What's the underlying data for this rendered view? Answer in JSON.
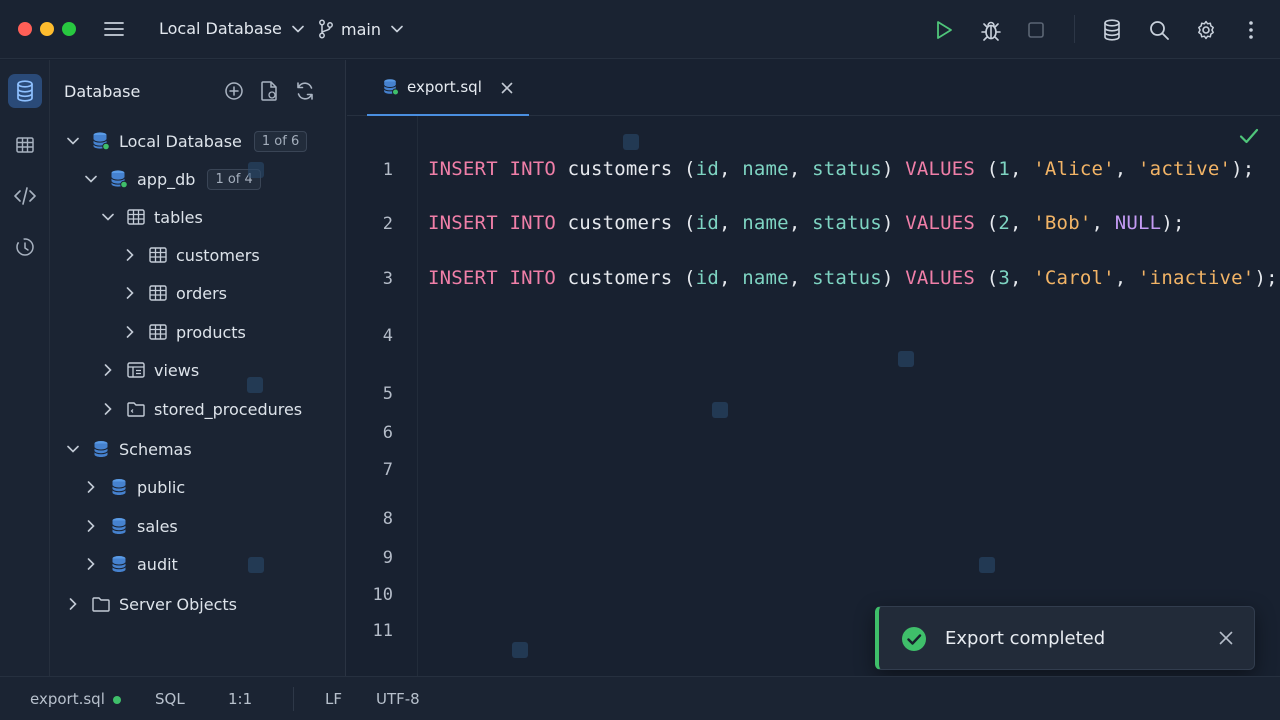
{
  "titlebar": {
    "connection": "Local Database",
    "branch": "main"
  },
  "sidebar": {
    "title": "Database",
    "tree": [
      {
        "label": "Local Database",
        "badge": "1 of 6"
      },
      {
        "label": "app_db",
        "badge": "1 of 4"
      },
      {
        "label": "tables"
      },
      {
        "label": "customers"
      },
      {
        "label": "orders"
      },
      {
        "label": "products"
      },
      {
        "label": "views"
      },
      {
        "label": "stored_procedures"
      },
      {
        "label": "Schemas"
      },
      {
        "label": "public"
      },
      {
        "label": "sales"
      },
      {
        "label": "audit"
      },
      {
        "label": "Server Objects"
      }
    ]
  },
  "editor": {
    "tab_label": "export.sql",
    "line_numbers": [
      "1",
      "2",
      "3",
      "4",
      "5",
      "6",
      "7",
      "8",
      "9",
      "10",
      "11"
    ],
    "lines": [
      [
        {
          "t": "INSERT INTO",
          "c": "kw"
        },
        {
          "t": " customers ("
        },
        {
          "t": "id",
          "c": "col"
        },
        {
          "t": ", "
        },
        {
          "t": "name",
          "c": "col"
        },
        {
          "t": ", "
        },
        {
          "t": "status",
          "c": "col"
        },
        {
          "t": ") "
        },
        {
          "t": "VALUES",
          "c": "kw"
        },
        {
          "t": " ("
        },
        {
          "t": "1",
          "c": "num"
        },
        {
          "t": ", "
        },
        {
          "t": "'Alice'",
          "c": "str"
        },
        {
          "t": ", "
        },
        {
          "t": "'active'",
          "c": "str"
        },
        {
          "t": ");"
        }
      ],
      [
        {
          "t": "INSERT INTO",
          "c": "kw"
        },
        {
          "t": " customers ("
        },
        {
          "t": "id",
          "c": "col"
        },
        {
          "t": ", "
        },
        {
          "t": "name",
          "c": "col"
        },
        {
          "t": ", "
        },
        {
          "t": "status",
          "c": "col"
        },
        {
          "t": ") "
        },
        {
          "t": "VALUES",
          "c": "kw"
        },
        {
          "t": " ("
        },
        {
          "t": "2",
          "c": "num"
        },
        {
          "t": ", "
        },
        {
          "t": "'Bob'",
          "c": "str"
        },
        {
          "t": ", "
        },
        {
          "t": "NULL",
          "c": "nul"
        },
        {
          "t": ");"
        }
      ],
      [
        {
          "t": "INSERT INTO",
          "c": "kw"
        },
        {
          "t": " customers ("
        },
        {
          "t": "id",
          "c": "col"
        },
        {
          "t": ", "
        },
        {
          "t": "name",
          "c": "col"
        },
        {
          "t": ", "
        },
        {
          "t": "status",
          "c": "col"
        },
        {
          "t": ") "
        },
        {
          "t": "VALUES",
          "c": "kw"
        },
        {
          "t": " ("
        },
        {
          "t": "3",
          "c": "num"
        },
        {
          "t": ", "
        },
        {
          "t": "'Carol'",
          "c": "str"
        },
        {
          "t": ", "
        },
        {
          "t": "'inactive'",
          "c": "str"
        },
        {
          "t": ");"
        }
      ]
    ]
  },
  "toast": {
    "message": "Export completed",
    "accent": "#3fbf6a"
  },
  "statusbar": {
    "file": "export.sql",
    "language": "SQL",
    "cursor": "1:1",
    "line_ending": "LF",
    "encoding": "UTF-8"
  }
}
